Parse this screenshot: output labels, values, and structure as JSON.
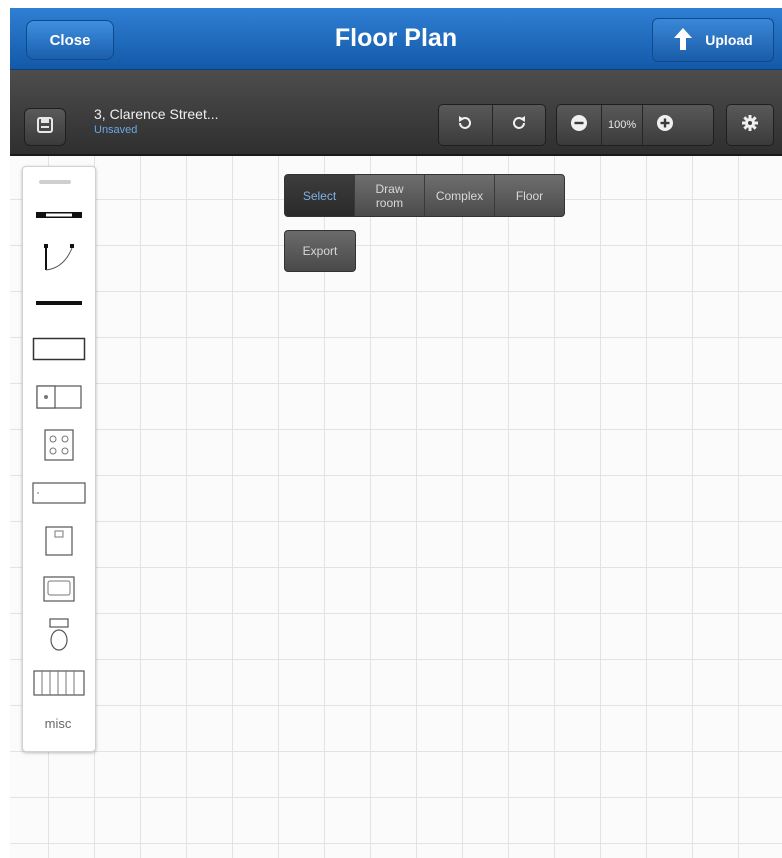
{
  "titlebar": {
    "close_label": "Close",
    "title": "Floor Plan",
    "upload_label": "Upload"
  },
  "toolbar": {
    "document_name": "3, Clarence Street...",
    "document_status": "Unsaved",
    "zoom_level": "100%"
  },
  "modes": {
    "select": "Select",
    "draw_room_line1": "Draw",
    "draw_room_line2": "room",
    "complex": "Complex",
    "floor": "Floor",
    "active": "Select"
  },
  "export_label": "Export",
  "palette": {
    "items": [
      "wall-segment",
      "door",
      "line",
      "room-rectangle",
      "appliance",
      "stove",
      "counter",
      "cabinet",
      "sink",
      "toilet",
      "radiator"
    ],
    "misc_label": "misc"
  },
  "colors": {
    "titlebar_blue": "#1f6cc0",
    "toolbar_dark": "#3d3d3d",
    "active_mode_text": "#7fb0e6",
    "status_text": "#6aa7e6"
  }
}
